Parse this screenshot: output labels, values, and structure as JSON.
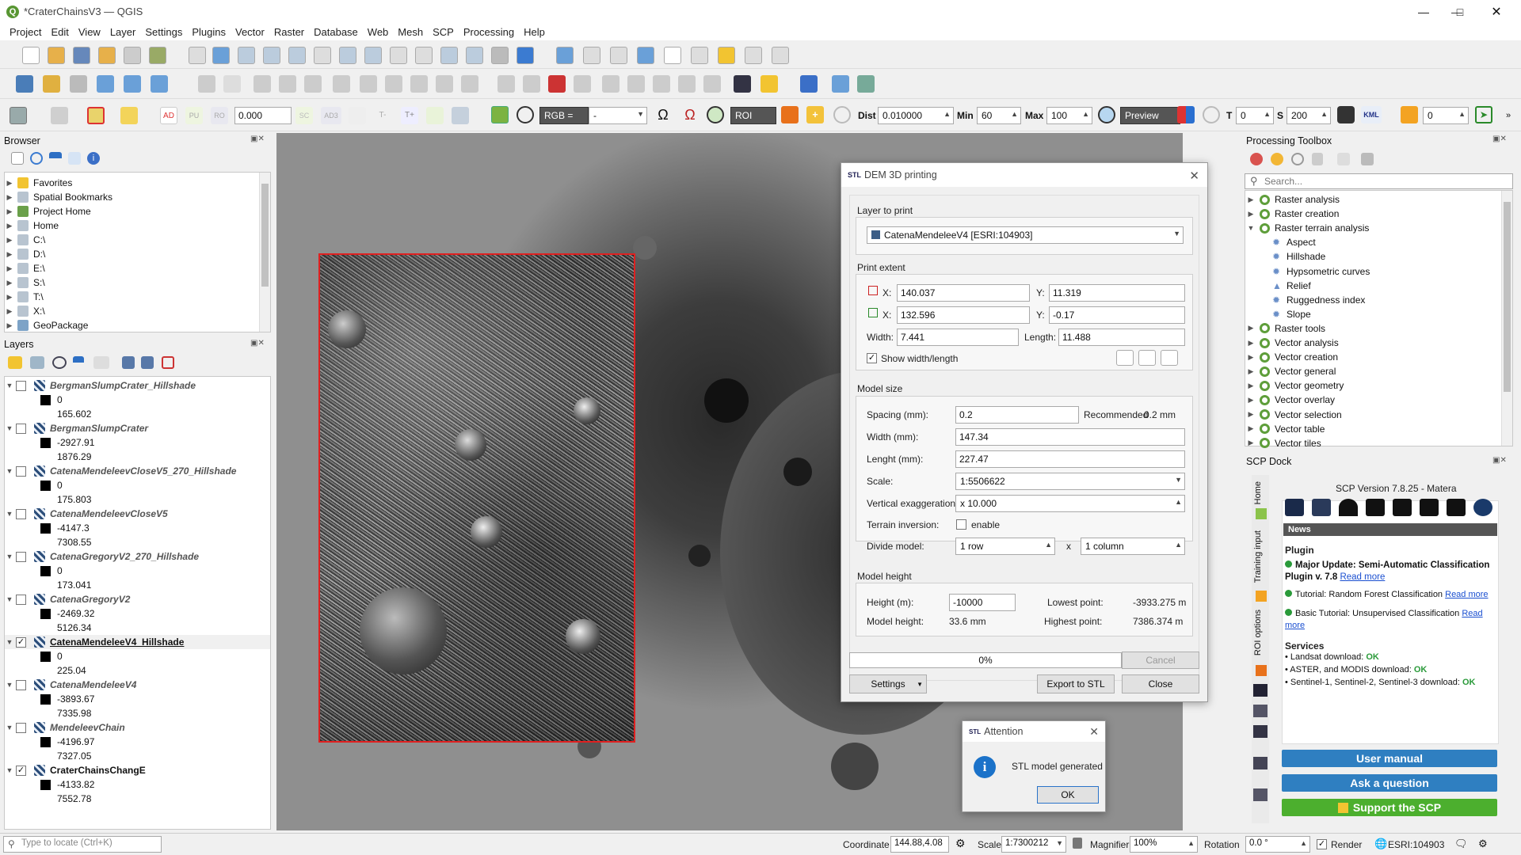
{
  "window": {
    "title": "*CraterChainsV3 — QGIS",
    "app_letter": "Q"
  },
  "menu": [
    "Project",
    "Edit",
    "View",
    "Layer",
    "Settings",
    "Plugins",
    "Vector",
    "Raster",
    "Database",
    "Web",
    "Mesh",
    "SCP",
    "Processing",
    "Help"
  ],
  "toolbar3": {
    "ad": "AD",
    "pu": "PU",
    "ro": "RO",
    "value": "0.000",
    "sc": "SC",
    "ad3": "AD3",
    "t_minus": "T-",
    "t_plus": "T+",
    "rgb": "RGB =",
    "rgb_value": "-",
    "roi": "ROI",
    "dist_label": "Dist",
    "dist_value": "0.010000",
    "min_label": "Min",
    "min_value": "60",
    "max_label": "Max",
    "max_value": "100",
    "preview": "Preview",
    "t_label": "T",
    "t_value": "0",
    "s_label": "S",
    "s_value": "200",
    "kml": "KML",
    "last_value": "0"
  },
  "browser": {
    "title": "Browser",
    "items": [
      {
        "label": "Favorites",
        "icon": "star-icon"
      },
      {
        "label": "Spatial Bookmarks",
        "icon": "bookmark-icon"
      },
      {
        "label": "Project Home",
        "icon": "folder-icon"
      },
      {
        "label": "Home",
        "icon": "home-icon"
      },
      {
        "label": "C:\\",
        "icon": "drive-icon"
      },
      {
        "label": "D:\\",
        "icon": "drive-icon"
      },
      {
        "label": "E:\\",
        "icon": "drive-icon"
      },
      {
        "label": "S:\\",
        "icon": "drive-icon"
      },
      {
        "label": "T:\\",
        "icon": "drive-icon"
      },
      {
        "label": "X:\\",
        "icon": "drive-icon"
      },
      {
        "label": "GeoPackage",
        "icon": "geopackage-icon"
      }
    ]
  },
  "layers": {
    "title": "Layers",
    "items": [
      {
        "name": "BergmanSlumpCrater_Hillshade",
        "checked": false,
        "v1": "0",
        "v2": "165.602"
      },
      {
        "name": "BergmanSlumpCrater",
        "checked": false,
        "v1": "-2927.91",
        "v2": "1876.29"
      },
      {
        "name": "CatenaMendeleevCloseV5_270_Hillshade",
        "checked": false,
        "v1": "0",
        "v2": "175.803"
      },
      {
        "name": "CatenaMendeleevCloseV5",
        "checked": false,
        "v1": "-4147.3",
        "v2": "7308.55"
      },
      {
        "name": "CatenaGregoryV2_270_Hillshade",
        "checked": false,
        "v1": "0",
        "v2": "173.041"
      },
      {
        "name": "CatenaGregoryV2",
        "checked": false,
        "v1": "-2469.32",
        "v2": "5126.34"
      },
      {
        "name": "CatenaMendeleeV4_Hillshade",
        "checked": true,
        "v1": "0",
        "v2": "225.04"
      },
      {
        "name": "CatenaMendeleeV4",
        "checked": false,
        "v1": "-3893.67",
        "v2": "7335.98"
      },
      {
        "name": "MendeleevChain",
        "checked": false,
        "v1": "-4196.97",
        "v2": "7327.05"
      },
      {
        "name": "CraterChainsChangE",
        "checked": true,
        "v1": "-4133.82",
        "v2": "7552.78"
      }
    ]
  },
  "dem_dialog": {
    "title": "DEM 3D printing",
    "title_badge": "STL",
    "layer_to_print_label": "Layer to print",
    "layer_value": "CatenaMendeleeV4 [ESRI:104903]",
    "print_extent_label": "Print extent",
    "x1": "140.037",
    "y1": "11.319",
    "x2": "132.596",
    "y2": "-0.17",
    "x_label": "X:",
    "y_label": "Y:",
    "width_label": "Width:",
    "width": "7.441",
    "length_label": "Length:",
    "length": "11.488",
    "show_wl": "Show width/length",
    "model_size_label": "Model size",
    "spacing_label": "Spacing (mm):",
    "spacing": "0.2",
    "recommended_label": "Recommended",
    "recommended": "0.2 mm",
    "width_mm_label": "Width (mm):",
    "width_mm": "147.34",
    "lenght_label": "Lenght (mm):",
    "lenght": "227.47",
    "scale_label": "Scale:",
    "scale": "1:5506622",
    "vex_label": "Vertical exaggeration:",
    "vex": "x 10.000",
    "inv_label": "Terrain inversion:",
    "inv_enable": "enable",
    "divide_label": "Divide model:",
    "divide_rows": "1 row",
    "divide_x": "x",
    "divide_cols": "1 column",
    "model_height_label": "Model height",
    "height_label": "Height (m):",
    "height": "-10000",
    "lowest_label": "Lowest point:",
    "lowest": "-3933.275 m",
    "mh_label": "Model height:",
    "mh": "33.6 mm",
    "highest_label": "Highest point:",
    "highest": "7386.374 m",
    "progress": "0%",
    "cancel": "Cancel",
    "settings": "Settings",
    "export": "Export to STL",
    "close": "Close"
  },
  "attention": {
    "badge": "STL",
    "title": "Attention",
    "message": "STL model generated",
    "ok": "OK"
  },
  "processing": {
    "title": "Processing Toolbox",
    "search_placeholder": "Search...",
    "items": [
      {
        "label": "Raster analysis",
        "level": 0
      },
      {
        "label": "Raster creation",
        "level": 0
      },
      {
        "label": "Raster terrain analysis",
        "level": 0,
        "open": true
      },
      {
        "label": "Aspect",
        "level": 1
      },
      {
        "label": "Hillshade",
        "level": 1
      },
      {
        "label": "Hypsometric curves",
        "level": 1
      },
      {
        "label": "Relief",
        "level": 1
      },
      {
        "label": "Ruggedness index",
        "level": 1
      },
      {
        "label": "Slope",
        "level": 1
      },
      {
        "label": "Raster tools",
        "level": 0
      },
      {
        "label": "Vector analysis",
        "level": 0
      },
      {
        "label": "Vector creation",
        "level": 0
      },
      {
        "label": "Vector general",
        "level": 0
      },
      {
        "label": "Vector geometry",
        "level": 0
      },
      {
        "label": "Vector overlay",
        "level": 0
      },
      {
        "label": "Vector selection",
        "level": 0
      },
      {
        "label": "Vector table",
        "level": 0
      },
      {
        "label": "Vector tiles",
        "level": 0
      }
    ]
  },
  "scp": {
    "title": "SCP Dock",
    "version": "SCP Version 7.8.25 - Matera",
    "side_tabs": [
      "Home",
      "Training input",
      "ROI options"
    ],
    "news_header": "News",
    "plugin_header": "Plugin",
    "news1_bold": "Major Update: Semi-Automatic Classification Plugin v. 7.8",
    "news1_link": "Read more",
    "news2": "Tutorial: Random Forest Classification",
    "news2_link": "Read more",
    "news3": "Basic Tutorial: Unsupervised Classification",
    "news3_link": "Read more",
    "services_header": "Services",
    "svc1": "• Landsat download:",
    "svc1_ok": "OK",
    "svc2": "• ASTER, and MODIS download:",
    "svc2_ok": "OK",
    "svc3": "• Sentinel-1, Sentinel-2, Sentinel-3 download:",
    "svc3_ok": "OK",
    "btn_manual": "User manual",
    "btn_ask": "Ask a question",
    "btn_support": "Support the SCP",
    "colors": {
      "blue": "#2f7fc1",
      "green": "#4caf2e"
    }
  },
  "status": {
    "locate_placeholder": "Type to locate (Ctrl+K)",
    "coord_label": "Coordinate",
    "coord": "144.88,4.08",
    "scale_label": "Scale",
    "scale": "1:7300212",
    "magnifier_label": "Magnifier",
    "magnifier": "100%",
    "rotation_label": "Rotation",
    "rotation": "0.0 °",
    "render": "Render",
    "crs": "ESRI:104903"
  }
}
